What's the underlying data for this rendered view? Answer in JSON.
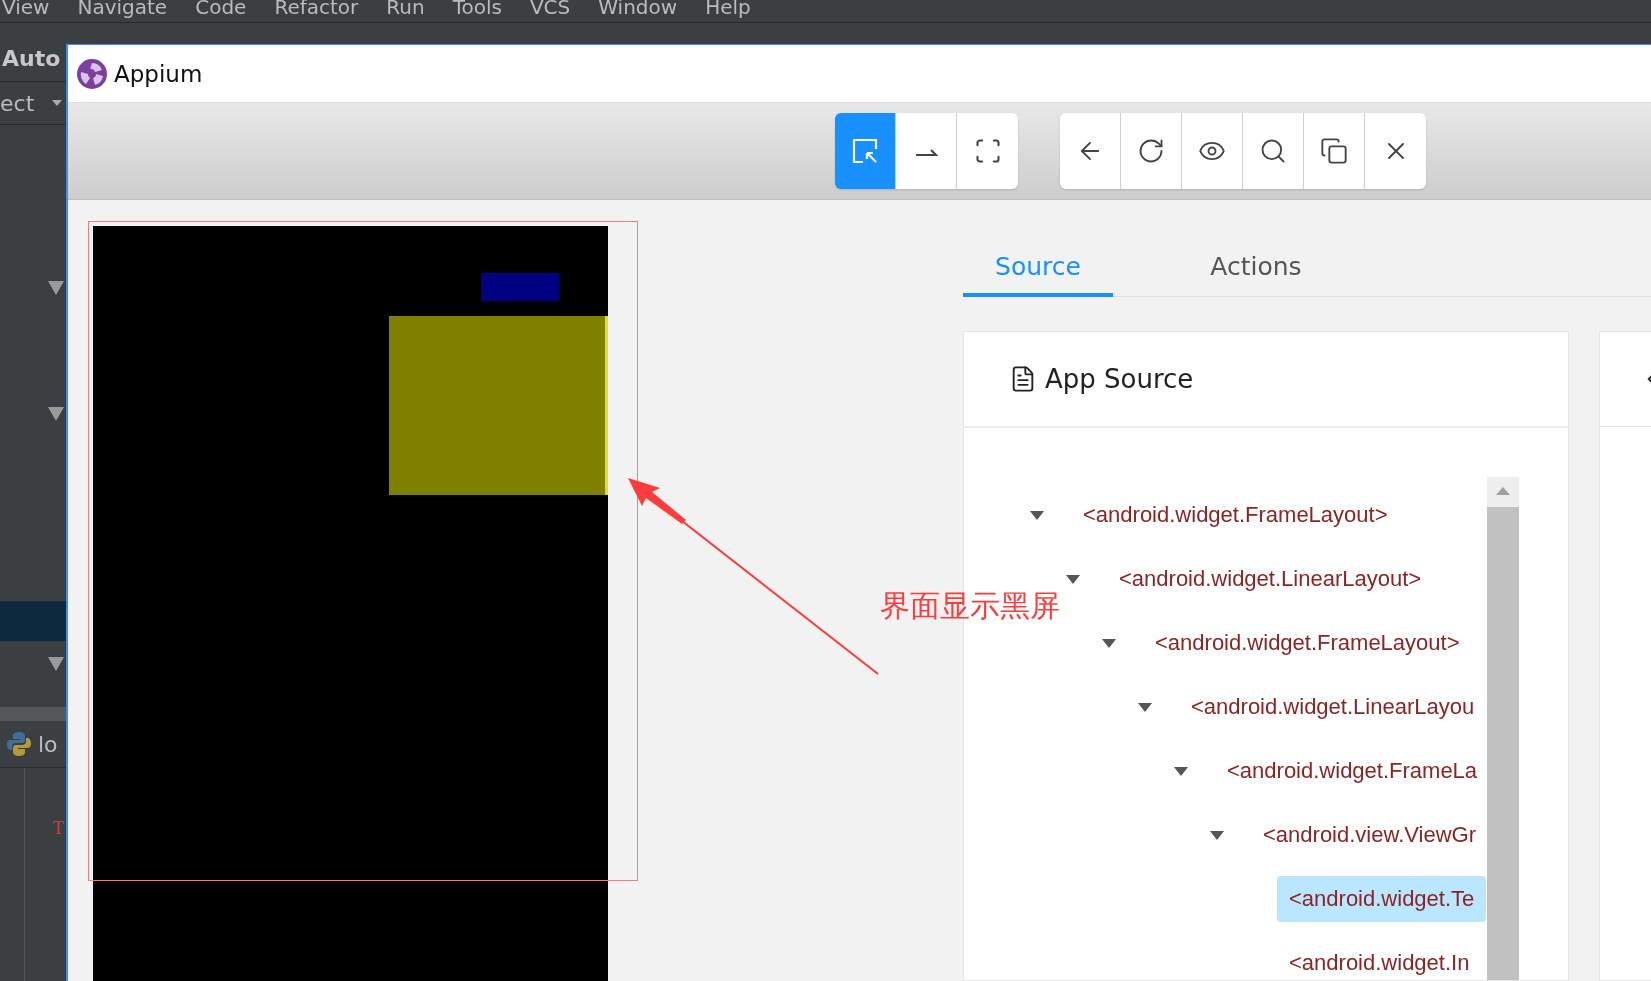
{
  "ide": {
    "menu": [
      "View",
      "Navigate",
      "Code",
      "Refactor",
      "Run",
      "Tools",
      "VCS",
      "Window",
      "Help"
    ],
    "sidebar": {
      "title": "Auto",
      "selector": "ect",
      "file_label": "lo",
      "gutter_mark": "T"
    }
  },
  "window": {
    "title": "Appium"
  },
  "toolbar": {
    "modes": [
      {
        "selected": true
      },
      {
        "selected": false
      },
      {
        "selected": false
      }
    ]
  },
  "annotation": "界面显示黑屏",
  "tabs": [
    {
      "label": "Source",
      "selected": true
    },
    {
      "label": "Actions",
      "selected": false
    }
  ],
  "source_panel": {
    "title": "App Source",
    "tree": [
      {
        "label": "<android.widget.FrameLayout>",
        "expanded": true,
        "selected": false,
        "children": [
          {
            "label": "<android.widget.LinearLayout>",
            "expanded": true,
            "selected": false,
            "children": [
              {
                "label": "<android.widget.FrameLayout>",
                "expanded": true,
                "selected": false,
                "children": [
                  {
                    "label": "<android.widget.LinearLayou",
                    "expanded": true,
                    "selected": false,
                    "children": [
                      {
                        "label": "<android.widget.FrameLa",
                        "expanded": true,
                        "selected": false,
                        "children": [
                          {
                            "label": "<android.view.ViewGr",
                            "expanded": true,
                            "selected": false,
                            "children": [
                              {
                                "label": "<android.widget.Te",
                                "selected": true
                              },
                              {
                                "label": "<android.widget.In",
                                "selected": false
                              }
                            ]
                          }
                        ]
                      }
                    ]
                  }
                ]
              }
            ]
          }
        ]
      }
    ]
  }
}
